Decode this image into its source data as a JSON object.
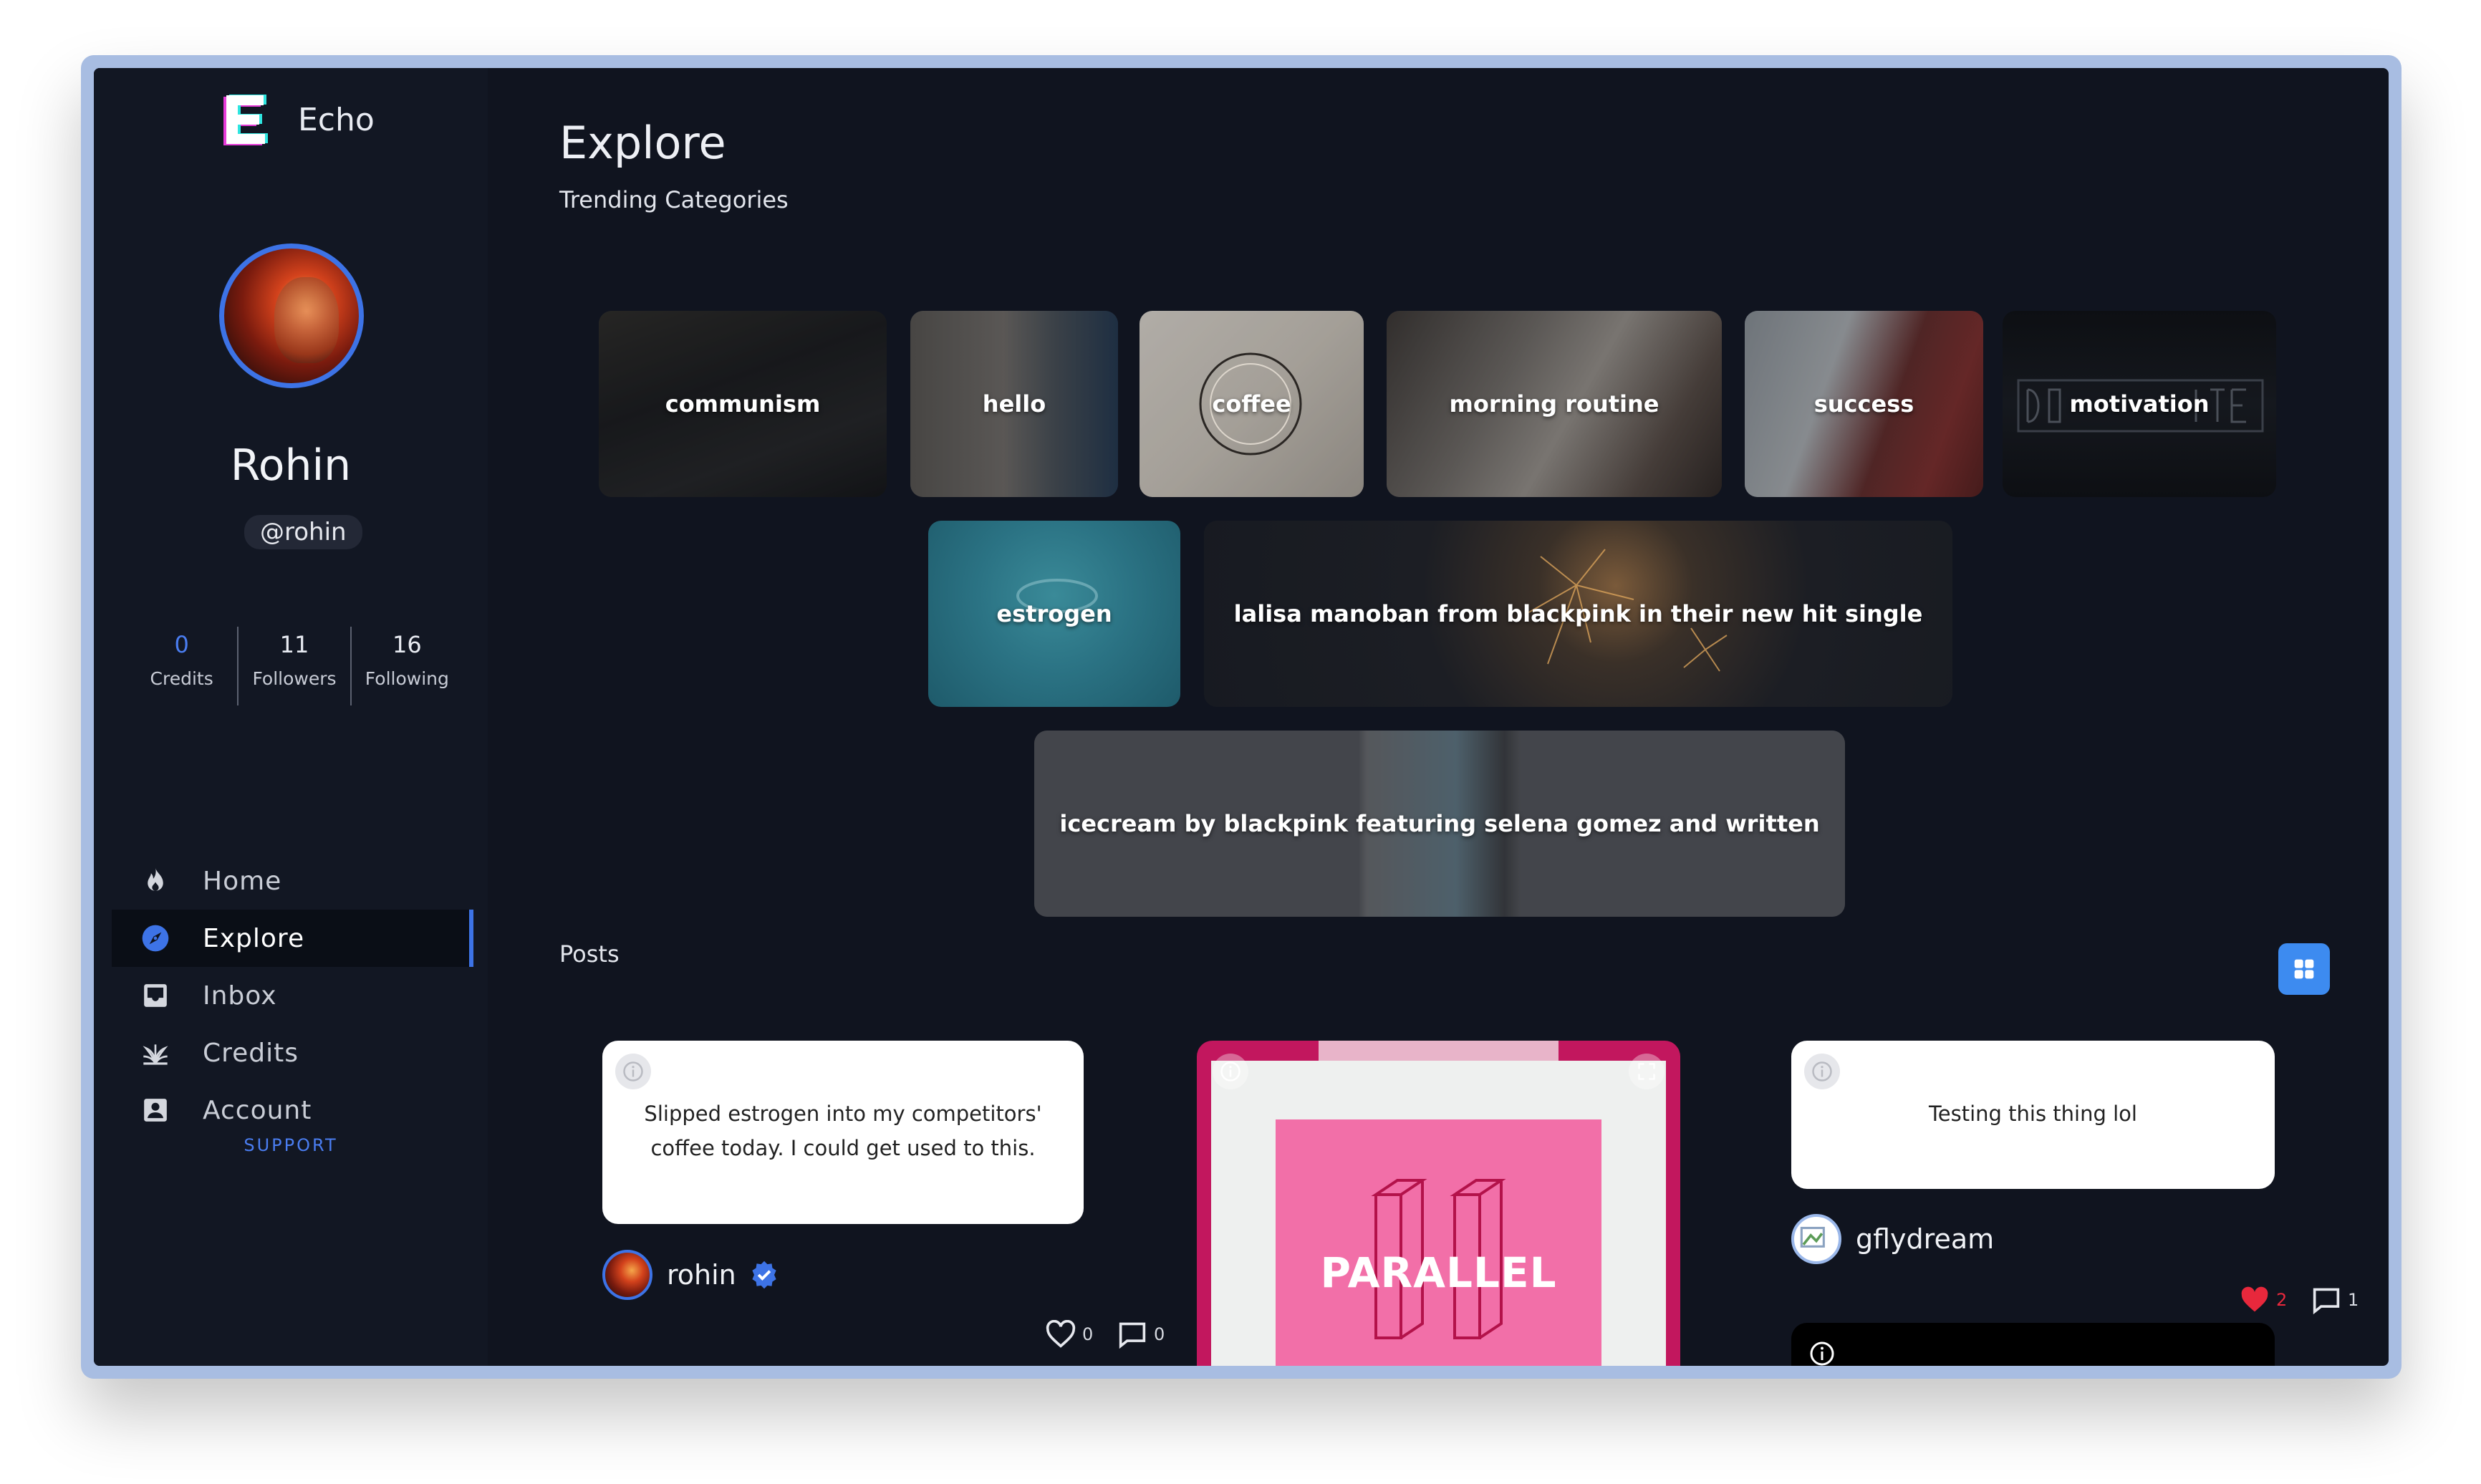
{
  "app": {
    "name": "Echo",
    "colors": {
      "accent": "#3d73e6",
      "background": "#10141f",
      "sidebar": "#121723"
    }
  },
  "profile": {
    "name": "Rohin",
    "handle": "@rohin",
    "stats": [
      {
        "value": "0",
        "label": "Credits"
      },
      {
        "value": "11",
        "label": "Followers"
      },
      {
        "value": "16",
        "label": "Following"
      }
    ]
  },
  "nav": {
    "items": [
      {
        "label": "Home",
        "icon": "flame-icon"
      },
      {
        "label": "Explore",
        "icon": "compass-icon",
        "active": true
      },
      {
        "label": "Inbox",
        "icon": "inbox-icon"
      },
      {
        "label": "Credits",
        "icon": "plant-icon"
      },
      {
        "label": "Account",
        "icon": "account-icon"
      }
    ],
    "support": "SUPPORT"
  },
  "main": {
    "title": "Explore",
    "subtitle": "Trending Categories",
    "categories": [
      "communism",
      "hello",
      "coffee",
      "morning routine",
      "success",
      "motivation",
      "estrogen",
      "lalisa manoban from blackpink in their new hit single",
      "icecream by blackpink featuring selena gomez and written"
    ],
    "posts_label": "Posts",
    "posts": [
      {
        "text": "Slipped estrogen into my competitors' coffee today. I could get used to this.",
        "author": "rohin",
        "likes": "0",
        "comments": "0"
      },
      {
        "image_text": "PARALLEL"
      },
      {
        "text": "Testing this thing lol",
        "author": "gflydream",
        "likes": "2",
        "comments": "1"
      }
    ]
  }
}
